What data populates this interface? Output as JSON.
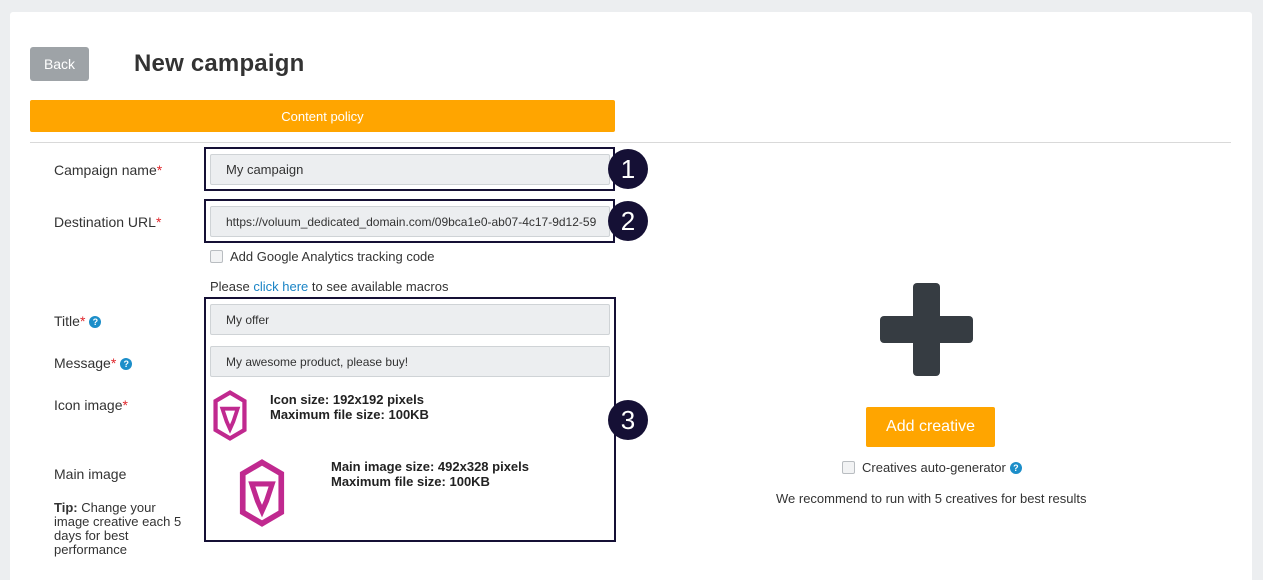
{
  "header": {
    "back_label": "Back",
    "title": "New campaign",
    "content_policy_label": "Content policy"
  },
  "form": {
    "campaign_name": {
      "label": "Campaign name",
      "required_mark": "*",
      "value": "My campaign"
    },
    "destination_url": {
      "label": "Destination URL",
      "required_mark": "*",
      "value": "https://voluum_dedicated_domain.com/09bca1e0-ab07-4c17-9d12-59"
    },
    "ga_tracking": {
      "label": "Add Google Analytics tracking code",
      "checked": false
    },
    "macros": {
      "prefix": "Please ",
      "link": "click here",
      "suffix": " to see available macros"
    },
    "title": {
      "label": "Title",
      "required_mark": "*",
      "help": "?",
      "value": "My offer"
    },
    "message": {
      "label": "Message",
      "required_mark": "*",
      "help": "?",
      "value": "My awesome product, please buy!"
    },
    "icon_image": {
      "label": "Icon image",
      "required_mark": "*",
      "size_text": "Icon size: 192x192 pixels",
      "max_text": "Maximum file size: 100KB"
    },
    "main_image": {
      "label": "Main image",
      "size_text": "Main image size: 492x328 pixels",
      "max_text": "Maximum file size: 100KB"
    },
    "tip": {
      "bold": "Tip:",
      "text": " Change your image creative each 5 days for best performance"
    }
  },
  "annotations": [
    "1",
    "2",
    "3"
  ],
  "creatives": {
    "add_label": "Add creative",
    "auto_generator_label": "Creatives auto-generator",
    "auto_generator_help": "?",
    "recommendation": "We recommend to run with 5 creatives for best results"
  },
  "colors": {
    "accent": "#ffa500",
    "link": "#1a84c6",
    "annotation": "#151035",
    "logo": "#c0298f",
    "required": "#e0262b"
  }
}
